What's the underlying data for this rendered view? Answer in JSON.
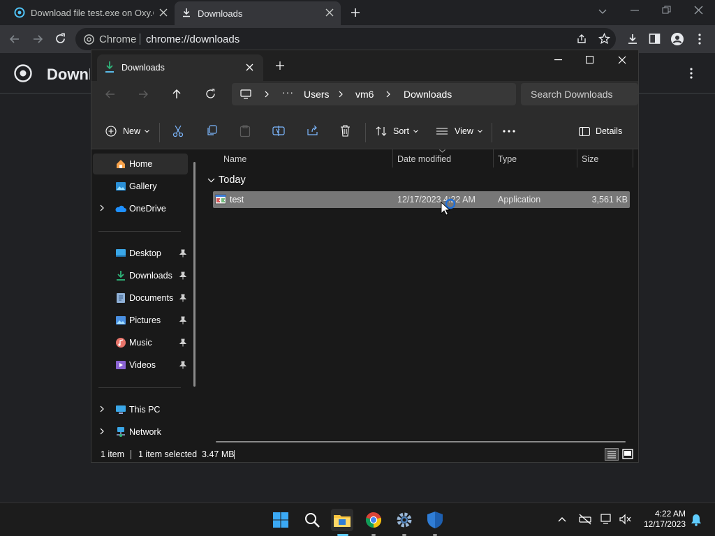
{
  "chrome": {
    "tabs": [
      {
        "title": "Download file test.exe on Oxy.Cl"
      },
      {
        "title": "Downloads"
      }
    ],
    "omnibox": {
      "label": "Chrome",
      "url": "chrome://downloads"
    },
    "page_title": "Downloads"
  },
  "explorer": {
    "tab_title": "Downloads",
    "breadcrumb": [
      "Users",
      "vm6",
      "Downloads"
    ],
    "search_placeholder": "Search Downloads",
    "commands": {
      "new": "New",
      "sort": "Sort",
      "view": "View",
      "details": "Details"
    },
    "nav": {
      "top": [
        {
          "label": "Home"
        },
        {
          "label": "Gallery"
        },
        {
          "label": "OneDrive"
        }
      ],
      "quick": [
        {
          "label": "Desktop"
        },
        {
          "label": "Downloads"
        },
        {
          "label": "Documents"
        },
        {
          "label": "Pictures"
        },
        {
          "label": "Music"
        },
        {
          "label": "Videos"
        }
      ],
      "bottom": [
        {
          "label": "This PC"
        },
        {
          "label": "Network"
        }
      ]
    },
    "columns": [
      "Name",
      "Date modified",
      "Type",
      "Size"
    ],
    "group": "Today",
    "files": [
      {
        "name": "test",
        "date": "12/17/2023 4:22 AM",
        "type": "Application",
        "size": "3,561 KB"
      }
    ],
    "status": {
      "count": "1 item",
      "selected": "1 item selected  3.47 MB"
    }
  },
  "taskbar": {
    "time": "4:22 AM",
    "date": "12/17/2023"
  },
  "colors": {
    "accent": "#60cdff",
    "folder": "#f9c440",
    "selection": "#777777"
  }
}
